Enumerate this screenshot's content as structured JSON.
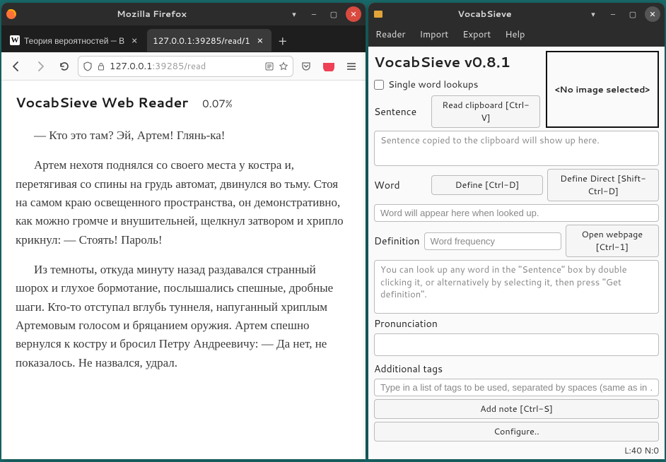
{
  "firefox": {
    "title": "Mozilla Firefox",
    "tabs": [
      {
        "title": "Теория вероятностей — В",
        "active": false,
        "favicon": "W"
      },
      {
        "title": "127.0.0.1:39285/read/1",
        "active": true,
        "favicon": ""
      }
    ],
    "url_display_prefix": "127.0.0.1",
    "url_display_suffix": ":39285/read",
    "page": {
      "header_title": "VocabSieve Web Reader",
      "progress": "0.07%",
      "paragraphs": [
        "— Кто это там? Эй, Артем! Глянь-ка!",
        "Артем нехотя поднялся со своего места у костра и, перетягивая со спины на грудь автомат, двинулся во тьму. Стоя на самом краю освещенного пространства, он демонстративно, как можно громче и внушительней, щелкнул затвором и хрипло крикнул: — Стоять! Пароль!",
        "Из темноты, откуда минуту назад раздавался странный шорох и глухое бормотание, послышались спешные, дробные шаги. Кто-то отступал вглубь туннеля, напуганный хриплым Артемовым голосом и бряцанием оружия. Артем спешно вернулся к костру и бросил Петру Андреевичу: — Да нет, не показалось. Не назвался, удрал."
      ]
    }
  },
  "vocabsieve": {
    "title": "VocabSieve",
    "menu": [
      "Reader",
      "Import",
      "Export",
      "Help"
    ],
    "heading": "VocabSieve v0.8.1",
    "single_word": "Single word lookups",
    "image_box": "<No image selected>",
    "labels": {
      "sentence": "Sentence",
      "word": "Word",
      "definition": "Definition",
      "pronunciation": "Pronunciation",
      "tags": "Additional tags"
    },
    "buttons": {
      "read_clipboard": "Read clipboard [Ctrl-V]",
      "define": "Define [Ctrl-D]",
      "define_direct": "Define Direct [Shift-Ctrl-D]",
      "open_webpage": "Open webpage [Ctrl-1]",
      "add_note": "Add note [Ctrl-S]",
      "configure": "Configure.."
    },
    "placeholders": {
      "sentence": "Sentence copied to the clipboard will show up here.",
      "word": "Word will appear here when looked up.",
      "freq": "Word frequency",
      "definition": "You can look up any word in the \"Sentence\" box by double clicking it, or alternatively by selecting it, then press \"Get definition\".",
      "tags": "Type in a list of tags to be used, separated by spaces (same as in …"
    },
    "status": "L:40 N:0"
  }
}
